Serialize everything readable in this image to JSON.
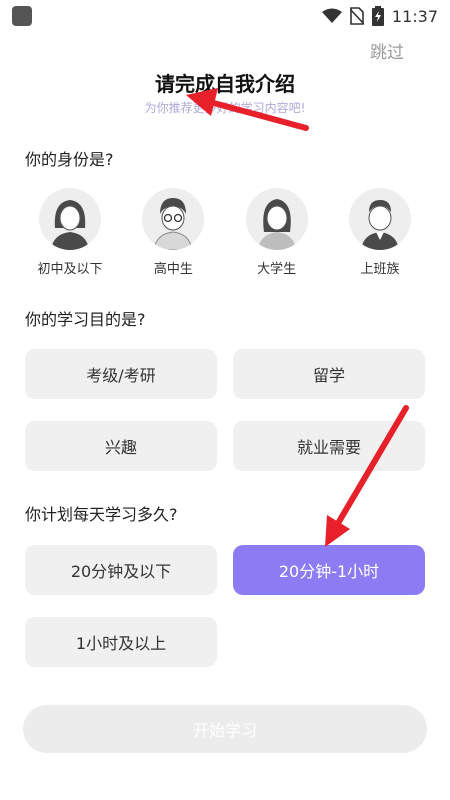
{
  "status_bar": {
    "time": "11:37",
    "icons": [
      "wifi-icon",
      "no-sim-icon",
      "battery-charging-icon"
    ]
  },
  "header": {
    "skip_label": "跳过",
    "title": "请完成自我介绍",
    "subtitle": "为你推荐更多好的学习内容吧!"
  },
  "identity_section": {
    "question": "你的身份是?",
    "options": [
      {
        "label": "初中及以下",
        "icon": "girl-long-hair-icon"
      },
      {
        "label": "高中生",
        "icon": "boy-glasses-icon"
      },
      {
        "label": "大学生",
        "icon": "girl-ponytail-icon"
      },
      {
        "label": "上班族",
        "icon": "man-suit-icon"
      }
    ]
  },
  "purpose_section": {
    "question": "你的学习目的是?",
    "options": [
      {
        "label": "考级/考研",
        "selected": false
      },
      {
        "label": "留学",
        "selected": false
      },
      {
        "label": "兴趣",
        "selected": false
      },
      {
        "label": "就业需要",
        "selected": false
      }
    ]
  },
  "time_section": {
    "question": "你计划每天学习多久?",
    "options": [
      {
        "label": "20分钟及以下",
        "selected": false
      },
      {
        "label": "20分钟-1小时",
        "selected": true
      },
      {
        "label": "1小时及以上",
        "selected": false
      }
    ]
  },
  "footer": {
    "start_label": "开始学习",
    "enabled": false
  },
  "colors": {
    "accent": "#8c7cf3",
    "option_bg": "#f0f0f0",
    "annotation_arrow": "#e8202a"
  }
}
